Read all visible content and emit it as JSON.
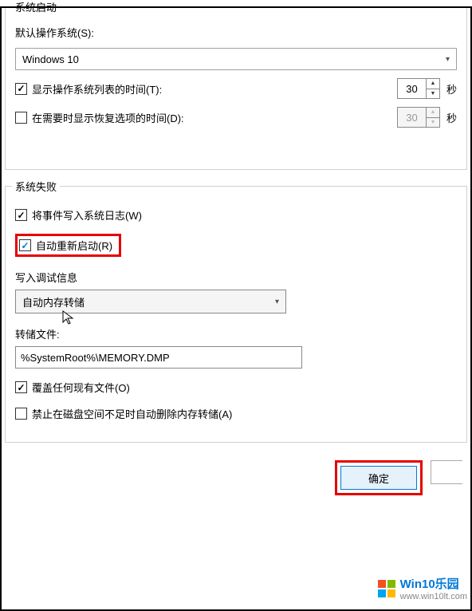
{
  "startup": {
    "group_title": "系统启动",
    "default_os_label": "默认操作系统(S):",
    "default_os_value": "Windows 10",
    "show_os_list_label": "显示操作系统列表的时间(T):",
    "show_os_list_checked": true,
    "show_os_list_value": "30",
    "show_recovery_label": "在需要时显示恢复选项的时间(D):",
    "show_recovery_checked": false,
    "show_recovery_value": "30",
    "seconds_unit": "秒"
  },
  "failure": {
    "group_title": "系统失败",
    "write_event_label": "将事件写入系统日志(W)",
    "write_event_checked": true,
    "auto_restart_label": "自动重新启动(R)",
    "auto_restart_checked": true,
    "debug_section_label": "写入调试信息",
    "dump_type_value": "自动内存转储",
    "dump_file_label": "转储文件:",
    "dump_file_value": "%SystemRoot%\\MEMORY.DMP",
    "overwrite_label": "覆盖任何现有文件(O)",
    "overwrite_checked": true,
    "disable_low_disk_label": "禁止在磁盘空间不足时自动删除内存转储(A)",
    "disable_low_disk_checked": false
  },
  "buttons": {
    "ok": "确定"
  },
  "watermark": {
    "brand": "Win10乐园",
    "url": "www.win10lt.com"
  }
}
